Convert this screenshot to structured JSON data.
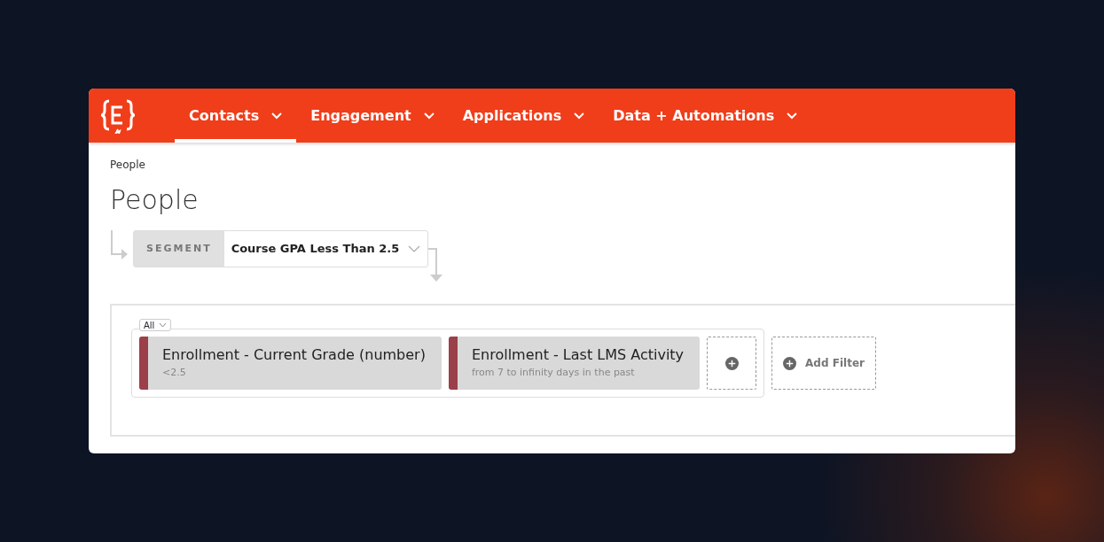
{
  "nav": {
    "tabs": [
      {
        "label": "Contacts",
        "selected": true
      },
      {
        "label": "Engagement",
        "selected": false
      },
      {
        "label": "Applications",
        "selected": false
      },
      {
        "label": "Data + Automations",
        "selected": false
      }
    ]
  },
  "breadcrumb": "People",
  "title": "People",
  "segment": {
    "label": "SEGMENT",
    "value": "Course GPA Less Than 2.5"
  },
  "filters": {
    "match": "All",
    "items": [
      {
        "name": "Enrollment - Current Grade (number)",
        "detail": "<2.5",
        "color": "#9b3f4a"
      },
      {
        "name": "Enrollment - Last LMS Activity",
        "detail": "from 7 to infinity days in the past",
        "color": "#9b3f4a"
      }
    ],
    "add_filter": "Add Filter"
  }
}
